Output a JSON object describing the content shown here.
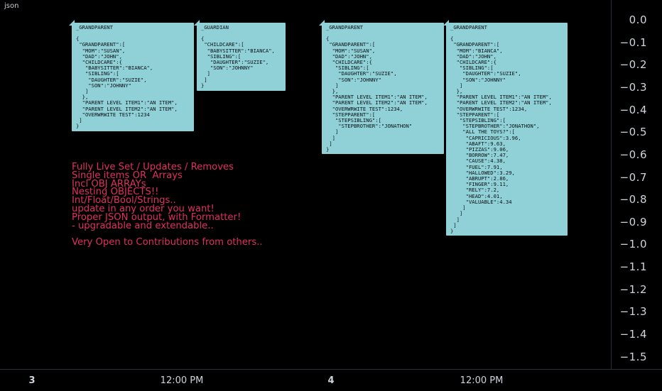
{
  "window": {
    "title": "json"
  },
  "labels": [
    {
      "header": "_GRANDPARENT",
      "lines": [
        "{",
        " \"GRANDPARENT\":[",
        "  \"MOM\":\"SUSAN\",",
        "  \"DAD\":\"JOHN\",",
        "  \"CHILDCARE\":{",
        "   \"BABYSITTER\":\"BIANCA\",",
        "   \"SIBLING\":[",
        "    \"DAUGHTER\":\"SUZIE\",",
        "    \"SON\":\"JOHNNY\"",
        "   ]",
        "  },",
        "  \"PARENT LEVEL ITEM1\":\"AN ITEM\",",
        "  \"PARENT LEVEL ITEM2\":\"AN ITEM\",",
        "  \"OVERWRWITE TEST\":1234",
        " ]",
        "}"
      ]
    },
    {
      "header": "_GUARDIAN",
      "lines": [
        "{",
        " \"CHILDCARE\":[",
        "  \"BABYSITTER\":\"BIANCA\",",
        "  \"SIBLING\":[",
        "   \"DAUGHTER\":\"SUZIE\",",
        "   \"SON\":\"JOHNNY\"",
        "  ]",
        " ]",
        "}"
      ]
    },
    {
      "header": "_GRANDPARENT",
      "lines": [
        "{",
        " \"GRANDPARENT\":[",
        "  \"MOM\":\"SUSAN\",",
        "  \"DAD\":\"JOHN\",",
        "  \"CHILDCARE\":{",
        "   \"SIBLING\":[",
        "    \"DAUGHTER\":\"SUZIE\",",
        "    \"SON\":\"JOHNNY\"",
        "   ]",
        "  },",
        "  \"PARENT LEVEL ITEM1\":\"AN ITEM\",",
        "  \"PARENT LEVEL ITEM2\":\"AN ITEM\",",
        "  \"OVERWRWITE TEST\":1234,",
        "  \"STEPPARENT\":[",
        "   \"STEPSIBLING\":[",
        "    \"STEPBROTHER\":\"JONATHON\"",
        "   ]",
        "  ]",
        " ]",
        "}"
      ]
    },
    {
      "header": "_GRANDPARENT",
      "lines": [
        "{",
        " \"GRANDPARENT\":[",
        "  \"MOM\":\"BIANCA\",",
        "  \"DAD\":\"JOHN\",",
        "  \"CHILDCARE\":{",
        "   \"SIBLING\":[",
        "    \"DAUGHTER\":\"SUZIE\",",
        "    \"SON\":\"JOHNNY\"",
        "   ]",
        "  },",
        "  \"PARENT LEVEL ITEM1\":\"AN ITEM\",",
        "  \"PARENT LEVEL ITEM2\":\"AN ITEM\",",
        "  \"OVERWRWITE TEST\":1234,",
        "  \"STEPPARENT\":[",
        "   \"STEPSIBLING\":[",
        "    \"STEPBROTHER\":\"JONATHON\",",
        "    \"ALL THE TOYS?\":[",
        "     \"CAPRICIOUS\":3.96,",
        "     \"ABAFT\":9.63,",
        "     \"PIZZAS\":9.06,",
        "     \"BORROW\":7.47,",
        "     \"CAUSE\":4.38,",
        "     \"FUEL\":7.91,",
        "     \"HALLOWED\":3.29,",
        "     \"ABRUPT\":2.86,",
        "     \"FINGER\":9.11,",
        "     \"RELY\":7.2,",
        "     \"HEAD\":4.01,",
        "     \"VALUABLE\":4.34",
        "    ]",
        "   ]",
        "  ]",
        " ]",
        "}"
      ]
    }
  ],
  "notes": [
    "Fully Live Set / Updates / Removes",
    "Single items OR  Arrays",
    "Incl OBJ ARRAYs",
    "Nesting OBJECTS!!",
    "Int/Float/Bool/Strings..",
    "update in any order you want!",
    "Proper JSON output, with Formatter!",
    "- upgradable and extendable..",
    "",
    "Very Open to Contributions from others.."
  ],
  "y_axis": {
    "ticks": [
      "0.0",
      "−0.1",
      "−0.2",
      "−0.3",
      "−0.4",
      "−0.5",
      "−0.6",
      "−0.7",
      "−0.8",
      "−0.9",
      "−1.0",
      "−1.1",
      "−1.2",
      "−1.3",
      "−1.4",
      "−1.5"
    ]
  },
  "x_axis": {
    "ticks": [
      {
        "label": "3",
        "bold": true
      },
      {
        "label": "12:00 PM",
        "bold": false
      },
      {
        "label": "4",
        "bold": true
      },
      {
        "label": "12:00 PM",
        "bold": false
      }
    ]
  },
  "colors": {
    "background": "#000000",
    "label_bg": "#8fd1d6",
    "note_text": "#e0305f",
    "axis_text": "#d1d4dc"
  }
}
